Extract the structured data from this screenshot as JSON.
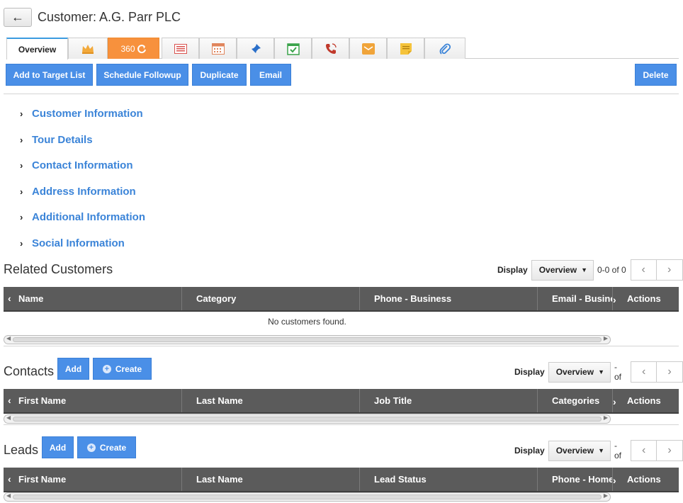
{
  "header": {
    "back_label": "←",
    "title": "Customer: A.G. Parr PLC"
  },
  "tabs": {
    "overview": "Overview",
    "t360": "360",
    "icons": [
      "crown-icon",
      "360-icon",
      "list-icon",
      "calendar-icon",
      "pin-icon",
      "task-check-icon",
      "phone-icon",
      "mail-icon",
      "note-icon",
      "paperclip-icon"
    ]
  },
  "toolbar": {
    "add_to_target_list": "Add to Target List",
    "schedule_followup": "Schedule Followup",
    "duplicate": "Duplicate",
    "email": "Email",
    "delete": "Delete"
  },
  "sections": [
    "Customer Information",
    "Tour Details",
    "Contact Information",
    "Address Information",
    "Additional Information",
    "Social Information"
  ],
  "related_customers": {
    "title": "Related Customers",
    "display_label": "Display",
    "display_value": "Overview",
    "count": "0-0 of 0",
    "columns": [
      "Name",
      "Category",
      "Phone - Business",
      "Email - Business",
      "Actions"
    ],
    "empty_text": "No customers found."
  },
  "contacts": {
    "title": "Contacts",
    "add": "Add",
    "create": "Create",
    "display_label": "Display",
    "display_value": "Overview",
    "count": "- of",
    "columns": [
      "First Name",
      "Last Name",
      "Job Title",
      "Categories",
      "Actions"
    ]
  },
  "leads": {
    "title": "Leads",
    "add": "Add",
    "create": "Create",
    "display_label": "Display",
    "display_value": "Overview",
    "count": "- of",
    "columns": [
      "First Name",
      "Last Name",
      "Lead Status",
      "Phone - Home",
      "Actions"
    ]
  },
  "colors": {
    "accent": "#4a8fe7",
    "link": "#3b84d8",
    "tab_360": "#f7913d",
    "table_header": "#5b5b5b"
  }
}
